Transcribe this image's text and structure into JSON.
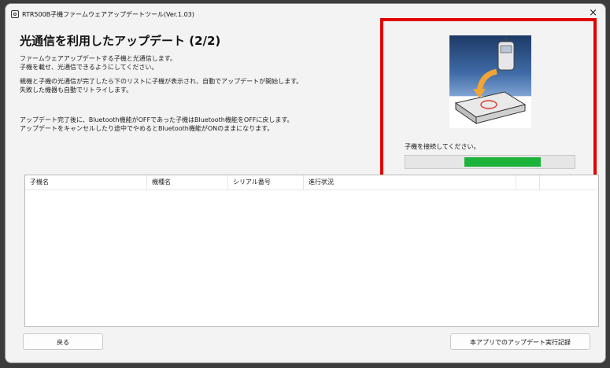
{
  "window": {
    "title": "RTR500B子機ファームウェアアップデートツール(Ver.1.03)",
    "close_glyph": "×"
  },
  "page": {
    "heading": "光通信を利用したアップデート (2/2)",
    "lines": [
      "ファームウェアアップデートする子機と光通信します。",
      "子機を載せ、光通信できるようにしてください。",
      "親機と子機の光通信が完了したら下のリストに子機が表示され、自動でアップデートが開始します。",
      "失敗した機器も自動でリトライします。",
      "アップデート完了後に、Bluetooth機能がOFFであった子機はBluetooth機能をOFFに戻します。",
      "アップデートをキャンセルしたり途中でやめるとBluetooth機能がONのままになります。"
    ]
  },
  "status_panel": {
    "message": "子機を接続してください。",
    "progress": {
      "start_fraction": 0.35,
      "end_fraction": 0.8,
      "color": "#1db33a"
    },
    "highlight_color": "#e30000"
  },
  "table": {
    "columns": [
      "子機名",
      "機種名",
      "シリアル番号",
      "進行状況",
      "",
      ""
    ],
    "rows": []
  },
  "buttons": {
    "back": "戻る",
    "history": "本アプリでのアップデート実行記録"
  }
}
